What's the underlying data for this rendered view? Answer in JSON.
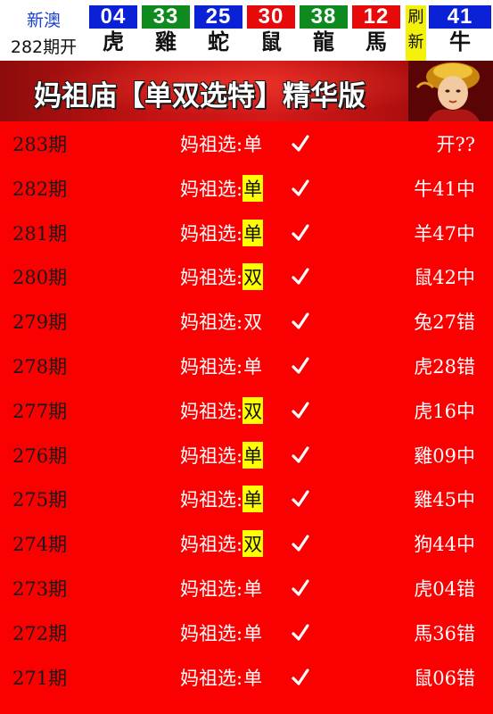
{
  "header": {
    "brand_line1": "新澳",
    "brand_line2": "282期开",
    "balls": [
      {
        "number": "04",
        "zodiac": "虎",
        "color": "blue"
      },
      {
        "number": "33",
        "zodiac": "雞",
        "color": "green"
      },
      {
        "number": "25",
        "zodiac": "蛇",
        "color": "blue"
      },
      {
        "number": "30",
        "zodiac": "鼠",
        "color": "red"
      },
      {
        "number": "38",
        "zodiac": "龍",
        "color": "green"
      },
      {
        "number": "12",
        "zodiac": "馬",
        "color": "red"
      }
    ],
    "refresh_label_top": "刷",
    "refresh_label_bottom": "新",
    "special_ball": {
      "number": "41",
      "zodiac": "牛",
      "color": "blue"
    }
  },
  "banner": {
    "title": "妈祖庙【单双选特】精华版"
  },
  "pick_prefix": "妈祖选:",
  "rows": [
    {
      "issue": "283期",
      "pick": "单",
      "highlight": false,
      "result": "开??"
    },
    {
      "issue": "282期",
      "pick": "单",
      "highlight": true,
      "result": "牛41中"
    },
    {
      "issue": "281期",
      "pick": "单",
      "highlight": true,
      "result": "羊47中"
    },
    {
      "issue": "280期",
      "pick": "双",
      "highlight": true,
      "result": "鼠42中"
    },
    {
      "issue": "279期",
      "pick": "双",
      "highlight": false,
      "result": "兔27错"
    },
    {
      "issue": "278期",
      "pick": "单",
      "highlight": false,
      "result": "虎28错"
    },
    {
      "issue": "277期",
      "pick": "双",
      "highlight": true,
      "result": "虎16中"
    },
    {
      "issue": "276期",
      "pick": "单",
      "highlight": true,
      "result": "雞09中"
    },
    {
      "issue": "275期",
      "pick": "单",
      "highlight": true,
      "result": "雞45中"
    },
    {
      "issue": "274期",
      "pick": "双",
      "highlight": true,
      "result": "狗44中"
    },
    {
      "issue": "273期",
      "pick": "单",
      "highlight": false,
      "result": "虎04错"
    },
    {
      "issue": "272期",
      "pick": "单",
      "highlight": false,
      "result": "馬36错"
    },
    {
      "issue": "271期",
      "pick": "单",
      "highlight": false,
      "result": "鼠06错"
    }
  ],
  "colors": {
    "list_background": "#fa0000",
    "highlight": "#ffff00",
    "blue_ball": "#0a21d6",
    "green_ball": "#0e8a1e",
    "red_ball": "#e70a0a"
  }
}
